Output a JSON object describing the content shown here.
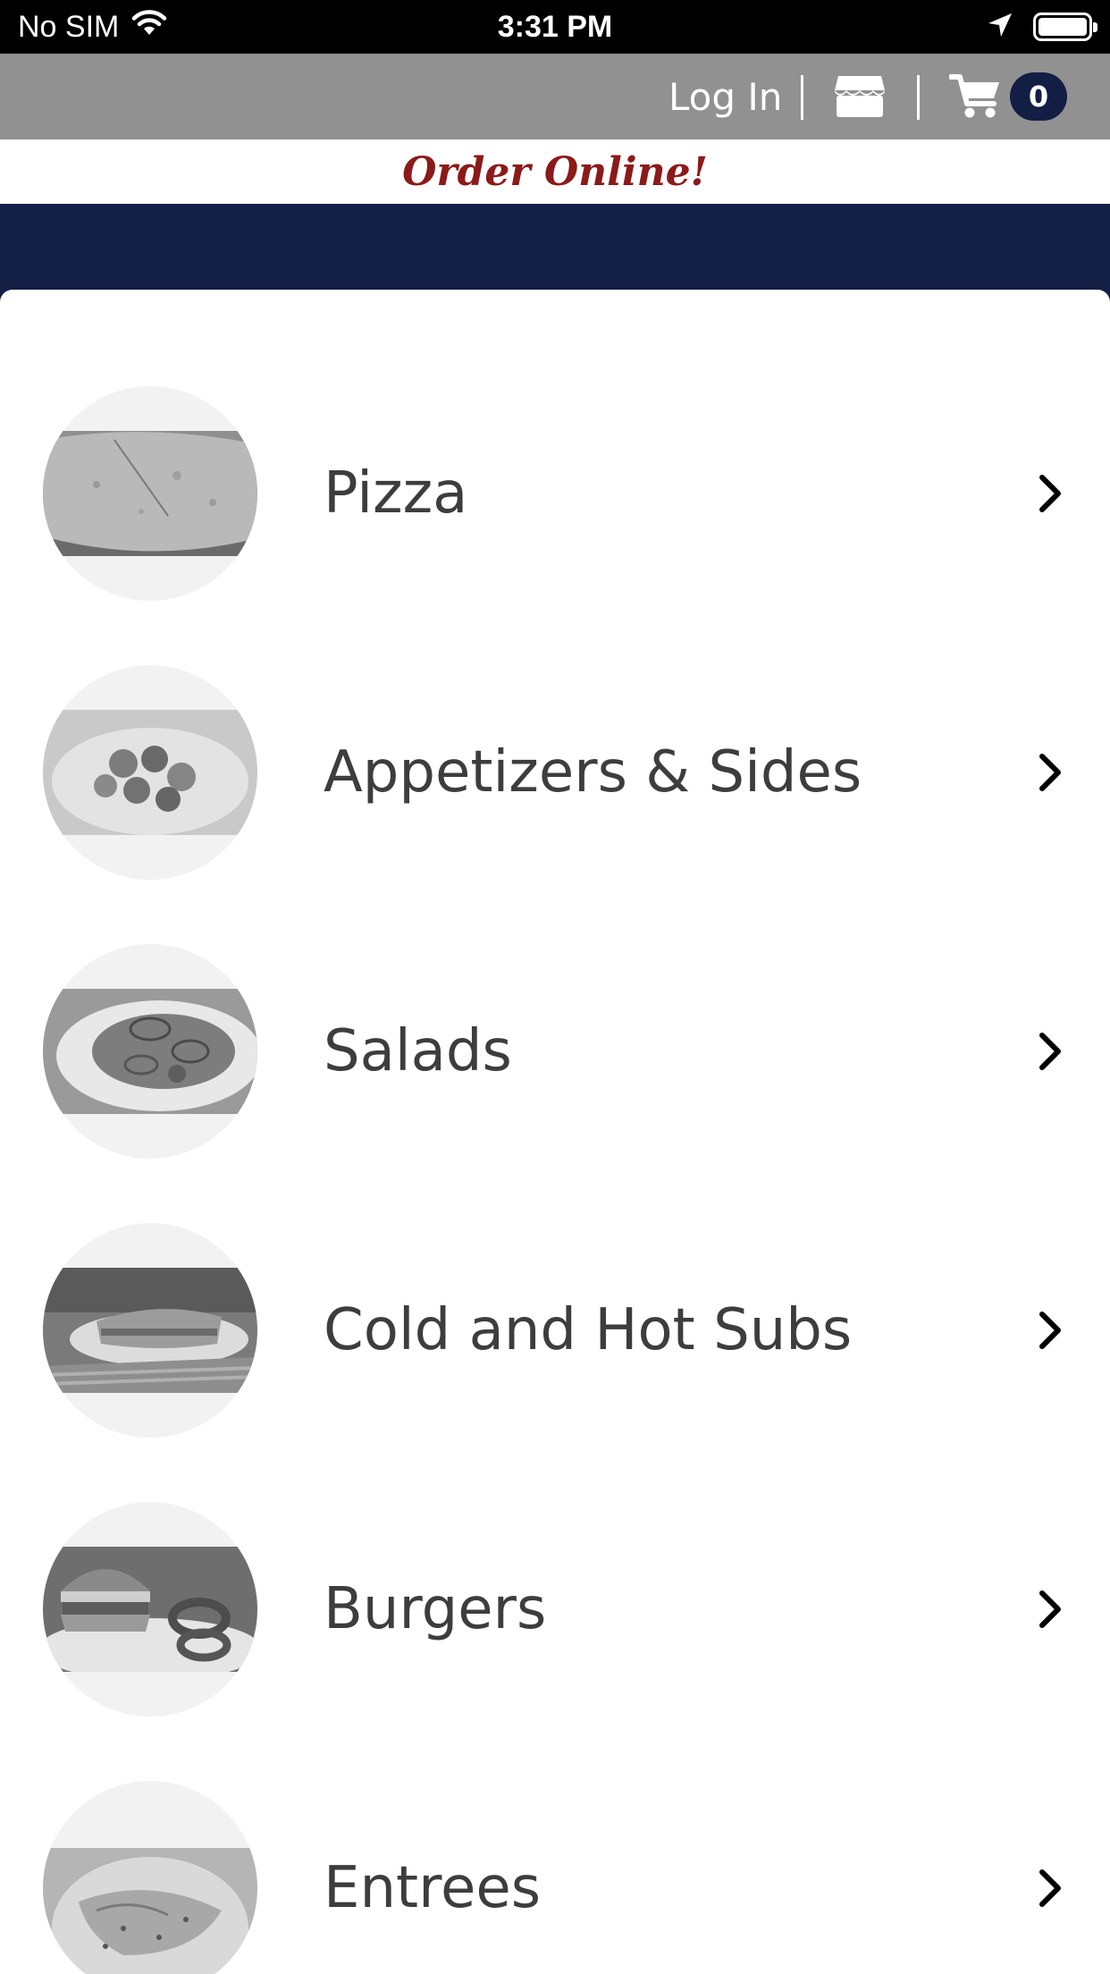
{
  "status_bar": {
    "carrier": "No SIM",
    "time": "3:31 PM"
  },
  "header": {
    "login_label": "Log In",
    "cart_count": "0"
  },
  "banner": {
    "text": "Order Online!"
  },
  "categories": [
    {
      "label": "Pizza",
      "image": "pizza-photo"
    },
    {
      "label": "Appetizers & Sides",
      "image": "appetizers-photo"
    },
    {
      "label": "Salads",
      "image": "salad-photo"
    },
    {
      "label": "Cold and Hot Subs",
      "image": "sub-photo"
    },
    {
      "label": "Burgers",
      "image": "burger-photo"
    },
    {
      "label": "Entrees",
      "image": "entree-photo"
    }
  ],
  "colors": {
    "status_bar": "#000000",
    "top_bar": "#919191",
    "accent_navy": "#141f46",
    "banner_red": "#8b1a1a",
    "label_text": "#3d3d3d"
  },
  "icons": [
    "wifi-icon",
    "location-arrow-icon",
    "battery-icon",
    "store-icon",
    "cart-icon",
    "chevron-right-icon"
  ]
}
